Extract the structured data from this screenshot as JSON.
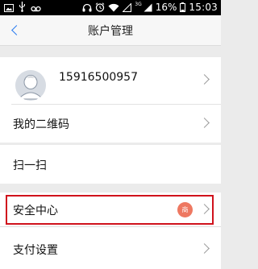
{
  "status_bar": {
    "network": "3G",
    "battery": "16%",
    "time": "15:03",
    "icons": [
      "image-icon",
      "usb-icon",
      "voicemail-icon",
      "headphones-icon",
      "alarm-icon",
      "wifi-icon",
      "signal-empty-icon",
      "signal-icon",
      "battery-icon"
    ]
  },
  "header": {
    "title": "账户管理",
    "back_icon": "back-chevron-icon"
  },
  "account": {
    "phone": "15916500957",
    "avatar_icon": "default-avatar-icon"
  },
  "menu": {
    "qr_code": "我的二维码",
    "scan": "扫一扫",
    "security": "安全中心",
    "security_badge": "商",
    "payment": "支付设置"
  },
  "colors": {
    "accent": "#2a7cf0",
    "highlight_border": "#d0121c",
    "badge": "#ee7861",
    "page_bg": "#ebebeb"
  }
}
